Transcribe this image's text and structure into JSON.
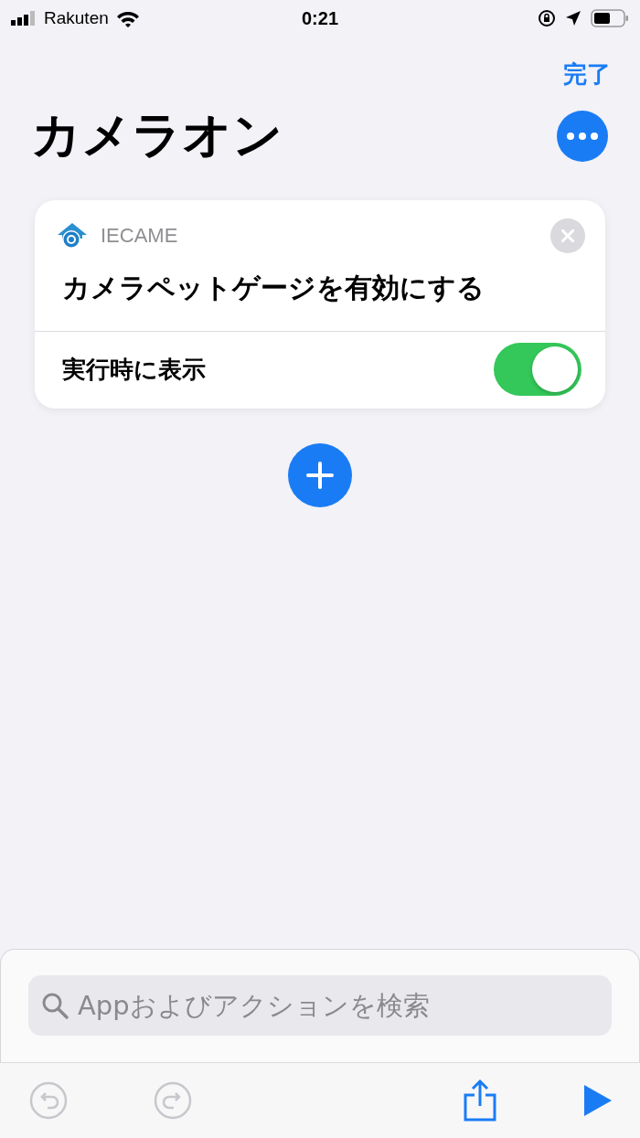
{
  "status_bar": {
    "carrier": "Rakuten",
    "time": "0:21"
  },
  "nav": {
    "done": "完了"
  },
  "title": "カメラオン",
  "action_card": {
    "app": "IECAME",
    "action": "カメラペットゲージを有効にする",
    "option": {
      "label": "実行時に表示",
      "on": true
    }
  },
  "search": {
    "placeholder": "Appおよびアクションを検索"
  },
  "toolbar": [
    {
      "kind": "undo",
      "disabled": true
    },
    {
      "kind": "redo",
      "disabled": true
    },
    {
      "kind": "share",
      "disabled": false
    },
    {
      "kind": "play",
      "disabled": false
    }
  ]
}
